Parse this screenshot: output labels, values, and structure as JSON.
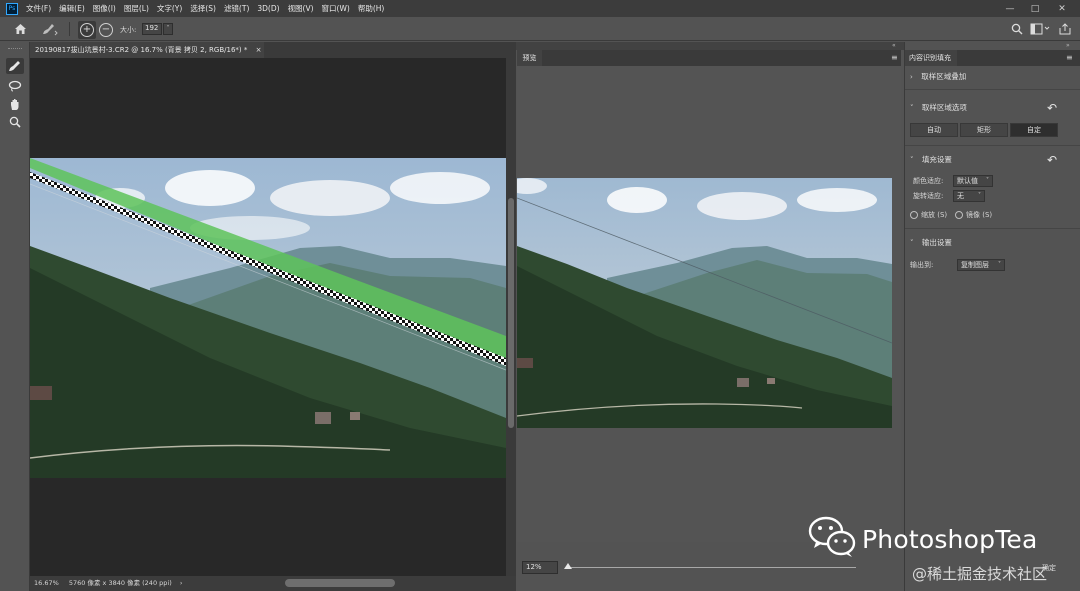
{
  "app": {
    "logo": "Ps"
  },
  "menu": [
    "文件(F)",
    "编辑(E)",
    "图像(I)",
    "图层(L)",
    "文字(Y)",
    "选择(S)",
    "滤镜(T)",
    "3D(D)",
    "视图(V)",
    "窗口(W)",
    "帮助(H)"
  ],
  "window_controls": [
    "—",
    "□",
    "✕"
  ],
  "options": {
    "size_label": "大小:",
    "size_value": "192"
  },
  "document": {
    "tab_title": "20190817拔山坑景村-3.CR2 @ 16.7% (背景 拷贝 2, RGB/16*) *",
    "tab_close": "×",
    "status_zoom": "16.67%",
    "status_info": "5760 像素 x 3840 像素 (240 ppi)"
  },
  "preview": {
    "tab_label": "预览",
    "zoom_value": "12%"
  },
  "content_aware_fill": {
    "tab_label": "内容识别填充",
    "sampling_overlay": "取样区域叠加",
    "sampling_options": "取样区域选项",
    "modes": [
      "自动",
      "矩形",
      "自定"
    ],
    "active_mode": "自定",
    "fill_settings": "填充设置",
    "color_adapt_label": "颜色适应:",
    "color_adapt_value": "默认值",
    "rotation_adapt_label": "旋转适应:",
    "rotation_adapt_value": "无",
    "scale_label": "缩放 (S)",
    "mirror_label": "镜像 (S)",
    "output_settings": "输出设置",
    "output_to_label": "输出到:",
    "output_to_value": "复制图层",
    "ok_button": "确定"
  },
  "watermark": {
    "title": "PhotoshopTea",
    "subtitle": "@稀土掘金技术社区"
  },
  "colors": {
    "ui_dark": "#282828",
    "panel": "#535353",
    "selection_green": "#5ec35a"
  },
  "icons": [
    "home-icon",
    "healing-brush-icon",
    "plus-circle-icon",
    "minus-circle-icon",
    "brush-tool-icon",
    "lasso-tool-icon",
    "hand-tool-icon",
    "zoom-tool-icon",
    "search-icon",
    "workspace-icon",
    "share-icon",
    "reset-icon",
    "wechat-icon"
  ]
}
